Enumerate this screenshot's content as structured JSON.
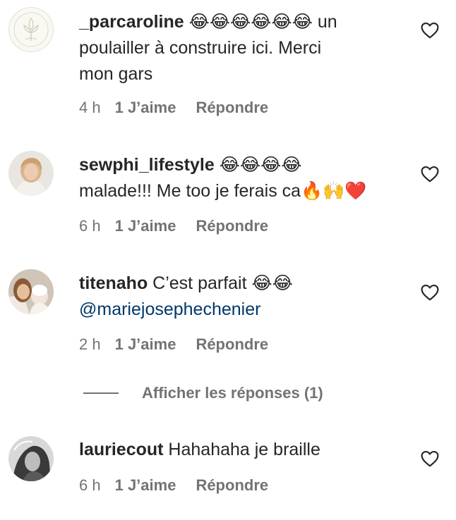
{
  "comments": [
    {
      "username": "_parcaroline",
      "line1": " 😂😂😂😂😂😂 un",
      "line2": "poulailler à construire ici. Merci",
      "line3": "mon gars",
      "time": "4 h",
      "likes": "1 J’aime",
      "reply": "Répondre",
      "avatar_icon": "floral-logo-avatar"
    },
    {
      "username": "sewphi_lifestyle",
      "line1": " 😂😂😂😂",
      "line2": "malade!!! Me too je ferais ca🔥🙌❤️",
      "time": "6 h",
      "likes": "1 J’aime",
      "reply": "Répondre",
      "avatar_icon": "person-photo-avatar"
    },
    {
      "username": "titenaho",
      "line1": " C’est parfait 😂😂",
      "mention": "@mariejosephechenier",
      "time": "2 h",
      "likes": "1 J’aime",
      "reply": "Répondre",
      "avatar_icon": "person-photo-avatar"
    },
    {
      "username": "lauriecout",
      "line1": " Hahahaha je braille",
      "time": "6 h",
      "likes": "1 J’aime",
      "reply": "Répondre",
      "avatar_icon": "person-photo-avatar"
    }
  ],
  "view_replies": {
    "label": "Afficher les réponses (1)"
  },
  "icons": {
    "like": "heart-outline-icon"
  },
  "colors": {
    "text": "#262626",
    "secondary": "#737373",
    "mention": "#00376b"
  }
}
